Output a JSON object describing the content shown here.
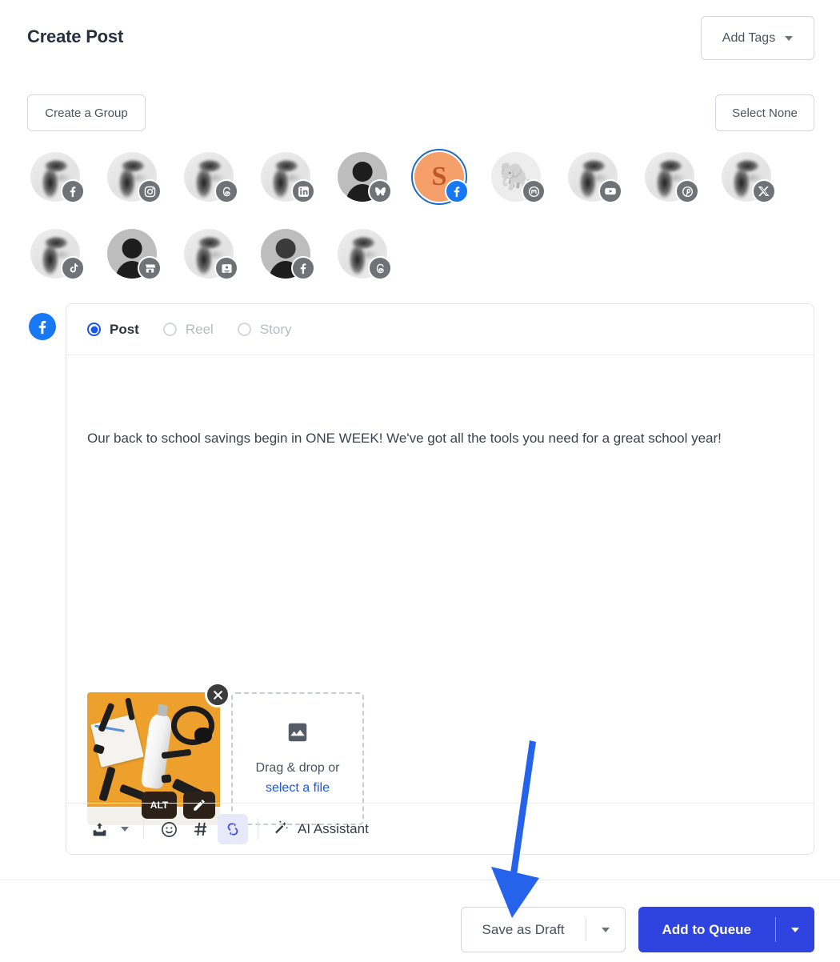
{
  "header": {
    "title": "Create Post",
    "add_tags_label": "Add Tags",
    "add_tags_icon": "chevron-down-icon"
  },
  "account_bar": {
    "create_group_label": "Create a Group",
    "select_none_label": "Select None"
  },
  "accounts": {
    "rows": [
      [
        {
          "network": "facebook",
          "avatar": "photo",
          "selected": false
        },
        {
          "network": "instagram",
          "avatar": "photo",
          "selected": false
        },
        {
          "network": "threads",
          "avatar": "photo",
          "selected": false
        },
        {
          "network": "linkedin",
          "avatar": "photo",
          "selected": false
        },
        {
          "network": "bluesky",
          "avatar": "person",
          "selected": false
        },
        {
          "network": "facebook",
          "avatar": "brand-s",
          "selected": true
        },
        {
          "network": "mastodon",
          "avatar": "elephant",
          "selected": false
        },
        {
          "network": "youtube",
          "avatar": "photo",
          "selected": false
        },
        {
          "network": "pinterest",
          "avatar": "photo",
          "selected": false
        },
        {
          "network": "x",
          "avatar": "photo",
          "selected": false
        }
      ],
      [
        {
          "network": "tiktok",
          "avatar": "photo",
          "selected": false
        },
        {
          "network": "google-business",
          "avatar": "person",
          "selected": false
        },
        {
          "network": "profile-card",
          "avatar": "photo",
          "selected": false
        },
        {
          "network": "facebook-group",
          "avatar": "person-locked",
          "selected": false
        },
        {
          "network": "threads",
          "avatar": "photo",
          "selected": false
        }
      ]
    ],
    "brand_letter": "S"
  },
  "editor": {
    "network_icon": "facebook-icon",
    "post_types": [
      {
        "label": "Post",
        "checked": true,
        "disabled": false
      },
      {
        "label": "Reel",
        "checked": false,
        "disabled": true
      },
      {
        "label": "Story",
        "checked": false,
        "disabled": true
      }
    ],
    "post_text": "Our back to school savings begin in ONE WEEK! We've got all the tools you need for a great school year!",
    "media": {
      "alt_label": "ALT",
      "edit_icon": "pencil-icon",
      "remove_icon": "close-icon",
      "image_description": "School supplies, water bottle and headphones on orange background"
    },
    "dropzone": {
      "icon": "image-icon",
      "text_prefix": "Drag & drop or ",
      "link_text": "select a file"
    },
    "toolbar": {
      "upload_icon": "upload-image-icon",
      "upload_caret_icon": "chevron-down-icon",
      "emoji_icon": "emoji-icon",
      "hashtag_icon": "hashtag-icon",
      "shortener_icon": "link-shortener-icon",
      "shortener_active": true,
      "ai_icon": "magic-wand-icon",
      "ai_label": "AI Assistant"
    }
  },
  "footer": {
    "draft_label": "Save as Draft",
    "draft_caret_icon": "chevron-down-icon",
    "queue_label": "Add to Queue",
    "queue_caret_icon": "chevron-down-icon"
  },
  "annotation": {
    "type": "arrow",
    "color": "#2563eb",
    "points_to": "Save as Draft"
  },
  "colors": {
    "primary": "#2f43e0",
    "accent_blue": "#1a56e8",
    "facebook": "#1877f2",
    "brand_orange": "#f5a06a",
    "arrow": "#2563eb"
  }
}
